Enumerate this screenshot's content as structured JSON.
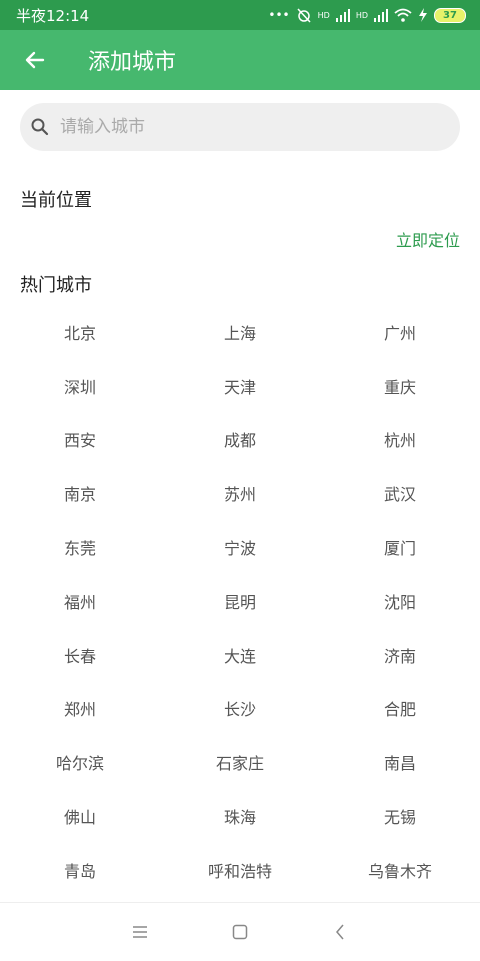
{
  "status_bar": {
    "time": "半夜12:14",
    "dots": "•••",
    "signal_label_1": "HD",
    "signal_label_2": "HD",
    "battery": "37"
  },
  "app_bar": {
    "title": "添加城市",
    "back_icon": "arrow-left-icon"
  },
  "search": {
    "placeholder": "请输入城市",
    "value": ""
  },
  "current_location": {
    "title": "当前位置",
    "action": "立即定位"
  },
  "hot_cities": {
    "title": "热门城市",
    "cities": [
      "北京",
      "上海",
      "广州",
      "深圳",
      "天津",
      "重庆",
      "西安",
      "成都",
      "杭州",
      "南京",
      "苏州",
      "武汉",
      "东莞",
      "宁波",
      "厦门",
      "福州",
      "昆明",
      "沈阳",
      "长春",
      "大连",
      "济南",
      "郑州",
      "长沙",
      "合肥",
      "哈尔滨",
      "石家庄",
      "南昌",
      "佛山",
      "珠海",
      "无锡",
      "青岛",
      "呼和浩特",
      "乌鲁木齐"
    ]
  },
  "colors": {
    "status_bar": "#2d9b4e",
    "app_bar": "#46b86e",
    "accent": "#2d9b4e"
  }
}
